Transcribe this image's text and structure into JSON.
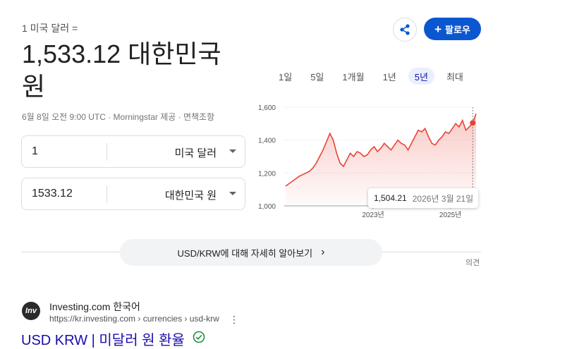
{
  "header": {
    "from_line": "1 미국 달러 =",
    "converted_value": "1,533.12 대한민국 원",
    "meta": "6월 8일 오전 9:00 UTC · Morningstar 제공 · 면책조항",
    "follow_label": "팔로우"
  },
  "converter": {
    "from": {
      "value": "1",
      "currency": "미국 달러"
    },
    "to": {
      "value": "1533.12",
      "currency": "대한민국 원"
    }
  },
  "range_tabs": [
    "1일",
    "5일",
    "1개월",
    "1년",
    "5년",
    "최대"
  ],
  "active_range": "5년",
  "chart_data": {
    "type": "line",
    "x_labels": [
      "2023년",
      "2025년"
    ],
    "y_ticks": [
      "1,600",
      "1,400",
      "1,200",
      "1,000"
    ],
    "ylim": [
      1000,
      1600
    ],
    "series": [
      {
        "values": [
          1120,
          1135,
          1150,
          1165,
          1180,
          1190,
          1200,
          1210,
          1230,
          1260,
          1300,
          1340,
          1390,
          1440,
          1400,
          1320,
          1260,
          1240,
          1280,
          1320,
          1300,
          1330,
          1320,
          1300,
          1310,
          1340,
          1360,
          1330,
          1350,
          1380,
          1360,
          1340,
          1370,
          1400,
          1380,
          1370,
          1340,
          1380,
          1420,
          1460,
          1450,
          1470,
          1420,
          1380,
          1370,
          1400,
          1420,
          1450,
          1440,
          1470,
          1500,
          1480,
          1520,
          1460,
          1480,
          1504,
          1560
        ]
      }
    ],
    "line_color": "#ea4335",
    "tooltip": {
      "value": "1,504.21",
      "date": "2026년 3월 21일"
    }
  },
  "learn_more": "USD/KRW에 대해 자세히 알아보기",
  "feedback": "의견",
  "result": {
    "site_name": "Investing.com 한국어",
    "url": "https://kr.investing.com › currencies › usd-krw",
    "title": "USD KRW | 미달러 원 환율",
    "favicon_text": "Inv"
  }
}
